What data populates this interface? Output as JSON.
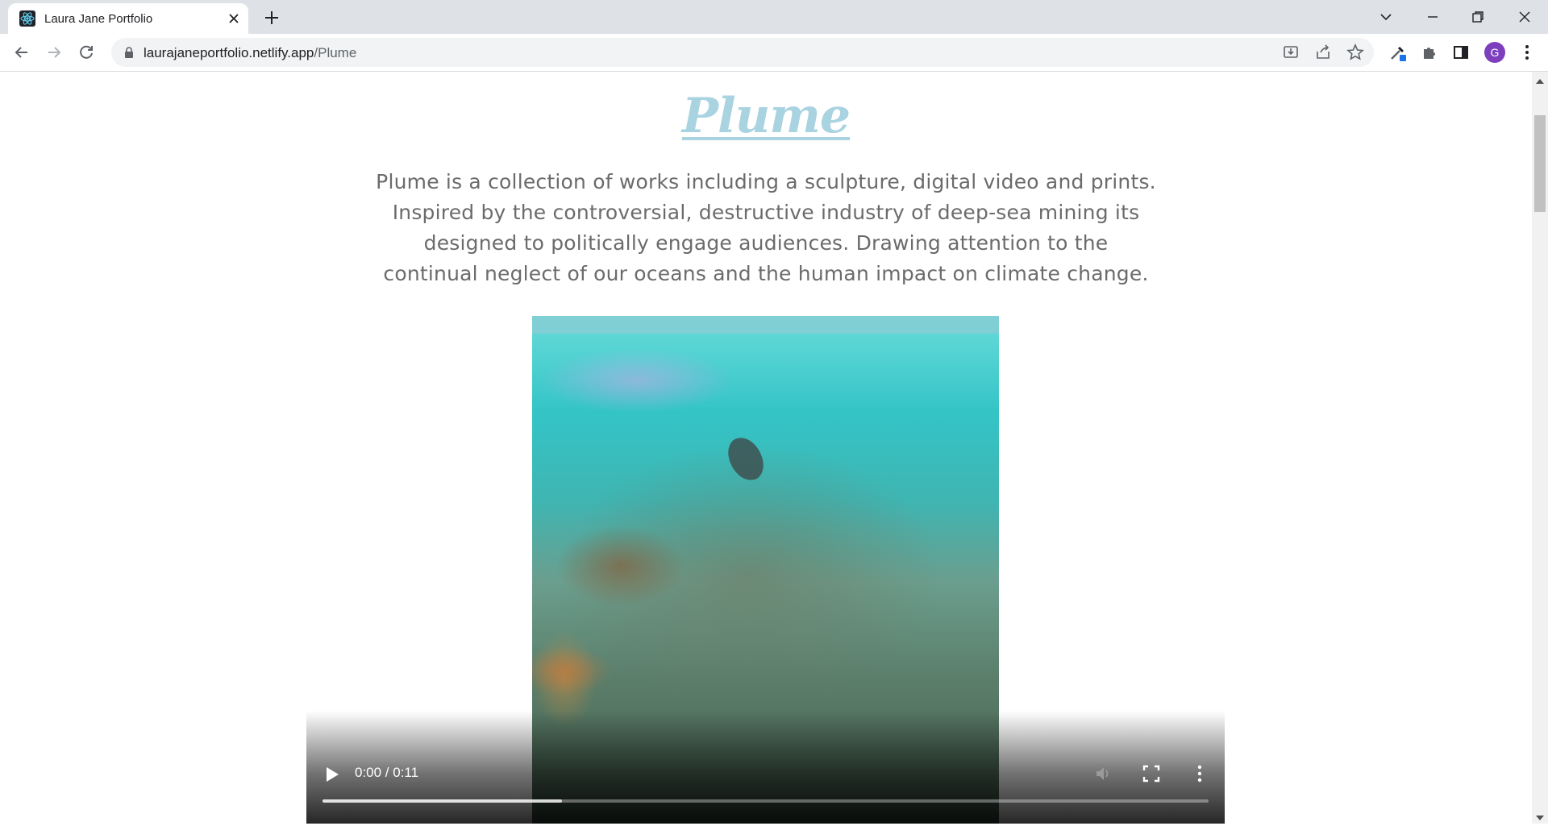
{
  "browser": {
    "tab": {
      "title": "Laura Jane Portfolio",
      "favicon": "react-logo-icon"
    },
    "url": {
      "domain": "laurajaneportfolio.netlify.app",
      "path": "/Plume"
    },
    "avatar_letter": "G"
  },
  "page": {
    "title": "Plume",
    "description_lines": [
      "Plume is a collection of works including a sculpture, digital video and prints.",
      "Inspired by the controversial, destructive industry of deep-sea mining its",
      "designed to politically engage audiences. Drawing attention to the",
      "continual neglect of our oceans and the human impact on climate change."
    ]
  },
  "video": {
    "time": "0:00 / 0:11",
    "progress_fraction": 0.27
  },
  "colors": {
    "title": "#a9d3e1",
    "text": "#6b6b6b",
    "avatar": "#7d3fbd"
  }
}
